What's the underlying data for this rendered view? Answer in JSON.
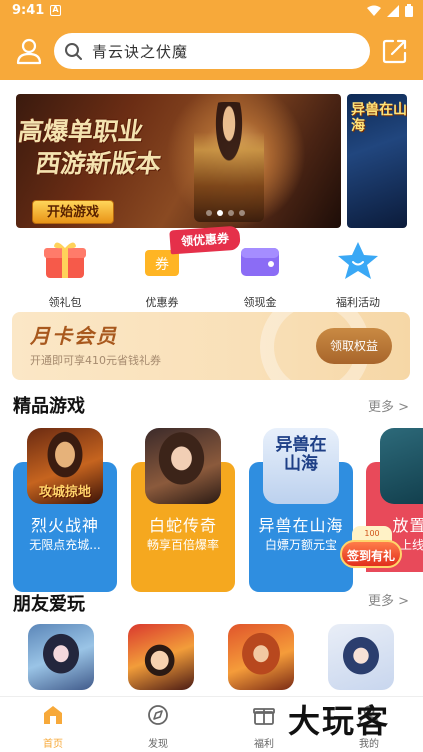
{
  "status_bar": {
    "time": "9:41",
    "notification_glyph": "A"
  },
  "header": {
    "search_placeholder": "青云诀之伏魔",
    "user_icon": "user-icon",
    "share_icon": "share-icon"
  },
  "banner": {
    "slogan_line1": "高爆单职业",
    "slogan_line2": "西游新版本",
    "start_button": "开始游戏",
    "next_banner_title": "异兽在山海",
    "dots_count": 4,
    "active_dot": 1
  },
  "quick_actions": [
    {
      "label": "领礼包",
      "icon": "gift-icon"
    },
    {
      "label": "优惠券",
      "icon": "coupon-icon",
      "badge": "领优惠券"
    },
    {
      "label": "领现金",
      "icon": "wallet-icon"
    },
    {
      "label": "福利活动",
      "icon": "star-icon"
    }
  ],
  "monthly_card": {
    "title": "月卡会员",
    "subtitle": "开通即可享410元省钱礼券",
    "button": "领取权益"
  },
  "featured": {
    "title": "精品游戏",
    "more": "更多 >",
    "games": [
      {
        "name": "烈火战神",
        "desc": "无限点充城...",
        "icon_label": "攻城掠地",
        "color": "#2f8ee0"
      },
      {
        "name": "白蛇传奇",
        "desc": "畅享百倍爆率",
        "color": "#f5a81f"
      },
      {
        "name": "异兽在山海",
        "desc": "白嫖万额元宝",
        "icon_label": "异兽在山海",
        "color": "#2f8ee0"
      },
      {
        "name": "放置乐",
        "desc": "上线策",
        "color": "#e84a5a"
      }
    ],
    "signin_badge": "签到有礼",
    "signin_cap": "100"
  },
  "friends": {
    "title": "朋友爱玩",
    "more": "更多 >"
  },
  "bottom_nav": [
    {
      "label": "首页",
      "icon": "home-icon",
      "active": true
    },
    {
      "label": "发现",
      "icon": "discover-icon",
      "active": false
    },
    {
      "label": "福利",
      "icon": "welfare-icon",
      "active": false
    },
    {
      "label": "我的",
      "icon": "profile-icon",
      "active": false
    }
  ],
  "watermark": "大玩客",
  "colors": {
    "brand": "#f7a93a",
    "blue": "#2f8ee0",
    "red": "#e5304a"
  }
}
